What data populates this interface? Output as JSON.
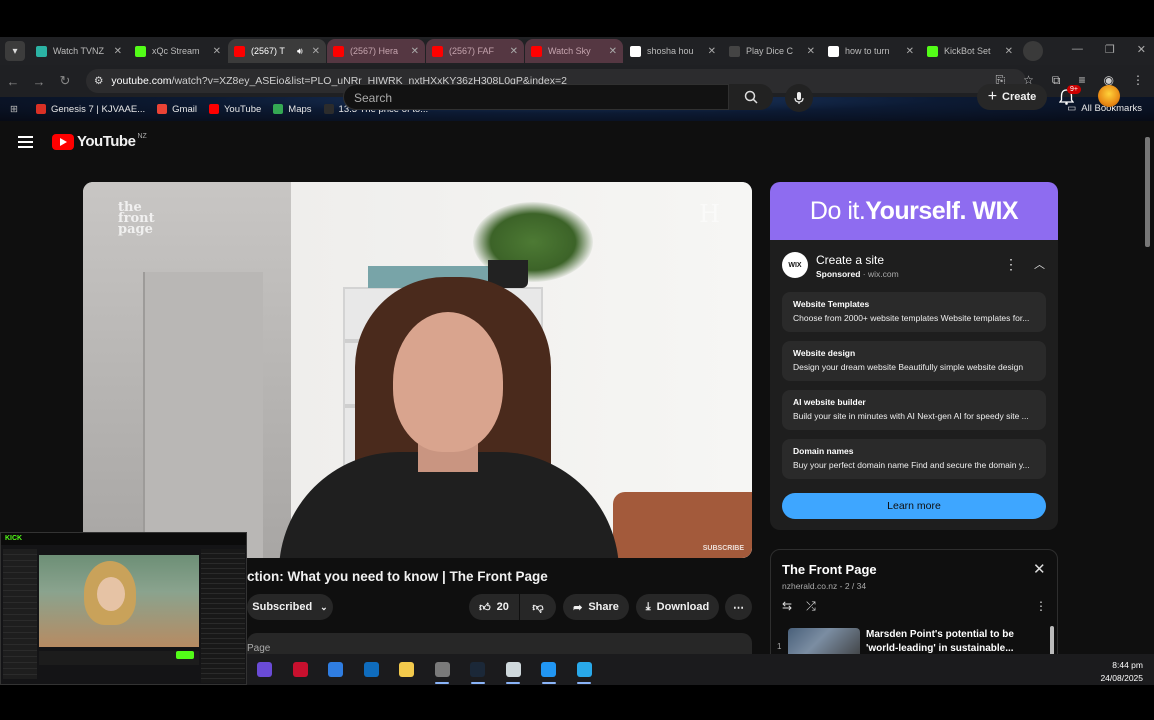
{
  "browser": {
    "tabs": [
      {
        "title": "Watch TVNZ",
        "fav": "#2bb3a4",
        "state": "normal"
      },
      {
        "title": "xQc Stream",
        "fav": "#53fc18",
        "state": "normal"
      },
      {
        "title": "(2567) T",
        "fav": "#ff0000",
        "state": "active"
      },
      {
        "title": "(2567) Hera",
        "fav": "#ff0000",
        "state": "dim"
      },
      {
        "title": "(2567) FAF",
        "fav": "#ff0000",
        "state": "dim"
      },
      {
        "title": "Watch Sky",
        "fav": "#ff0000",
        "state": "dim"
      },
      {
        "title": "shosha hou",
        "fav": "#ffffff",
        "state": "normal"
      },
      {
        "title": "Play Dice C",
        "fav": "#444444",
        "state": "normal"
      },
      {
        "title": "how to turn",
        "fav": "#ffffff",
        "state": "normal"
      },
      {
        "title": "KickBot Set",
        "fav": "#53fc18",
        "state": "normal"
      }
    ],
    "url_host": "youtube.com",
    "url_rest": "/watch?v=XZ8ey_ASEio&list=PLO_uNRr_HIWRK_nxtHXxKY36zH308L0qP&index=2",
    "bookmarks": [
      {
        "label": "Genesis 7 | KJVAAE...",
        "color": "#d93025"
      },
      {
        "label": "Gmail",
        "color": "#ea4335"
      },
      {
        "label": "YouTube",
        "color": "#ff0000"
      },
      {
        "label": "Maps",
        "color": "#34a853"
      },
      {
        "label": "13.3 The price of to...",
        "color": "#2c2c2c"
      }
    ],
    "all_bookmarks": "All Bookmarks"
  },
  "youtube": {
    "logo": "YouTube",
    "country": "NZ",
    "search_placeholder": "Search",
    "create_label": "Create",
    "notification_count": "9+"
  },
  "video": {
    "title": "ction: What you need to know | The Front Page",
    "watermark": "the front page",
    "watermark_right": "H",
    "subscribe_overlay": "SUBSCRIBE",
    "subscribed_label": "Subscribed",
    "likes": "20",
    "share_label": "Share",
    "download_label": "Download",
    "description_start": "Page"
  },
  "ad": {
    "banner_light": "Do it.",
    "banner_bold": "Yourself. WIX",
    "logo": "WIX",
    "title": "Create a site",
    "sponsored": "Sponsored",
    "domain": "· wix.com",
    "items": [
      {
        "heading": "Website Templates",
        "desc": "Choose from 2000+ website templates Website templates for..."
      },
      {
        "heading": "Website design",
        "desc": "Design your dream website Beautifully simple website design"
      },
      {
        "heading": "AI website builder",
        "desc": "Build your site in minutes with AI Next-gen AI for speedy site ..."
      },
      {
        "heading": "Domain names",
        "desc": "Buy your perfect domain name Find and secure the domain y..."
      }
    ],
    "learn_more": "Learn more"
  },
  "playlist": {
    "title": "The Front Page",
    "meta": "nzherald.co.nz - 2 / 34",
    "item_index": "1",
    "item_title": "Marsden Point's potential to be 'world-leading' in sustainable..."
  },
  "overlay": {
    "brand": "KICK"
  },
  "taskbar": {
    "time": "8:44 pm",
    "date": "24/08/2025",
    "apps": [
      {
        "name": "app-icon",
        "color": "#6a4bd6"
      },
      {
        "name": "flash-icon",
        "color": "#c8102e"
      },
      {
        "name": "store-icon",
        "color": "#2f7de1"
      },
      {
        "name": "outlook-icon",
        "color": "#0f6cbd"
      },
      {
        "name": "folder-icon",
        "color": "#f2c94c"
      },
      {
        "name": "edit-icon",
        "color": "#7a7a7a"
      },
      {
        "name": "steam-icon",
        "color": "#1b2838"
      },
      {
        "name": "notepad-icon",
        "color": "#cfd8dc"
      },
      {
        "name": "window-icon",
        "color": "#2196f3"
      },
      {
        "name": "telegram-icon",
        "color": "#29a9ea"
      }
    ]
  }
}
